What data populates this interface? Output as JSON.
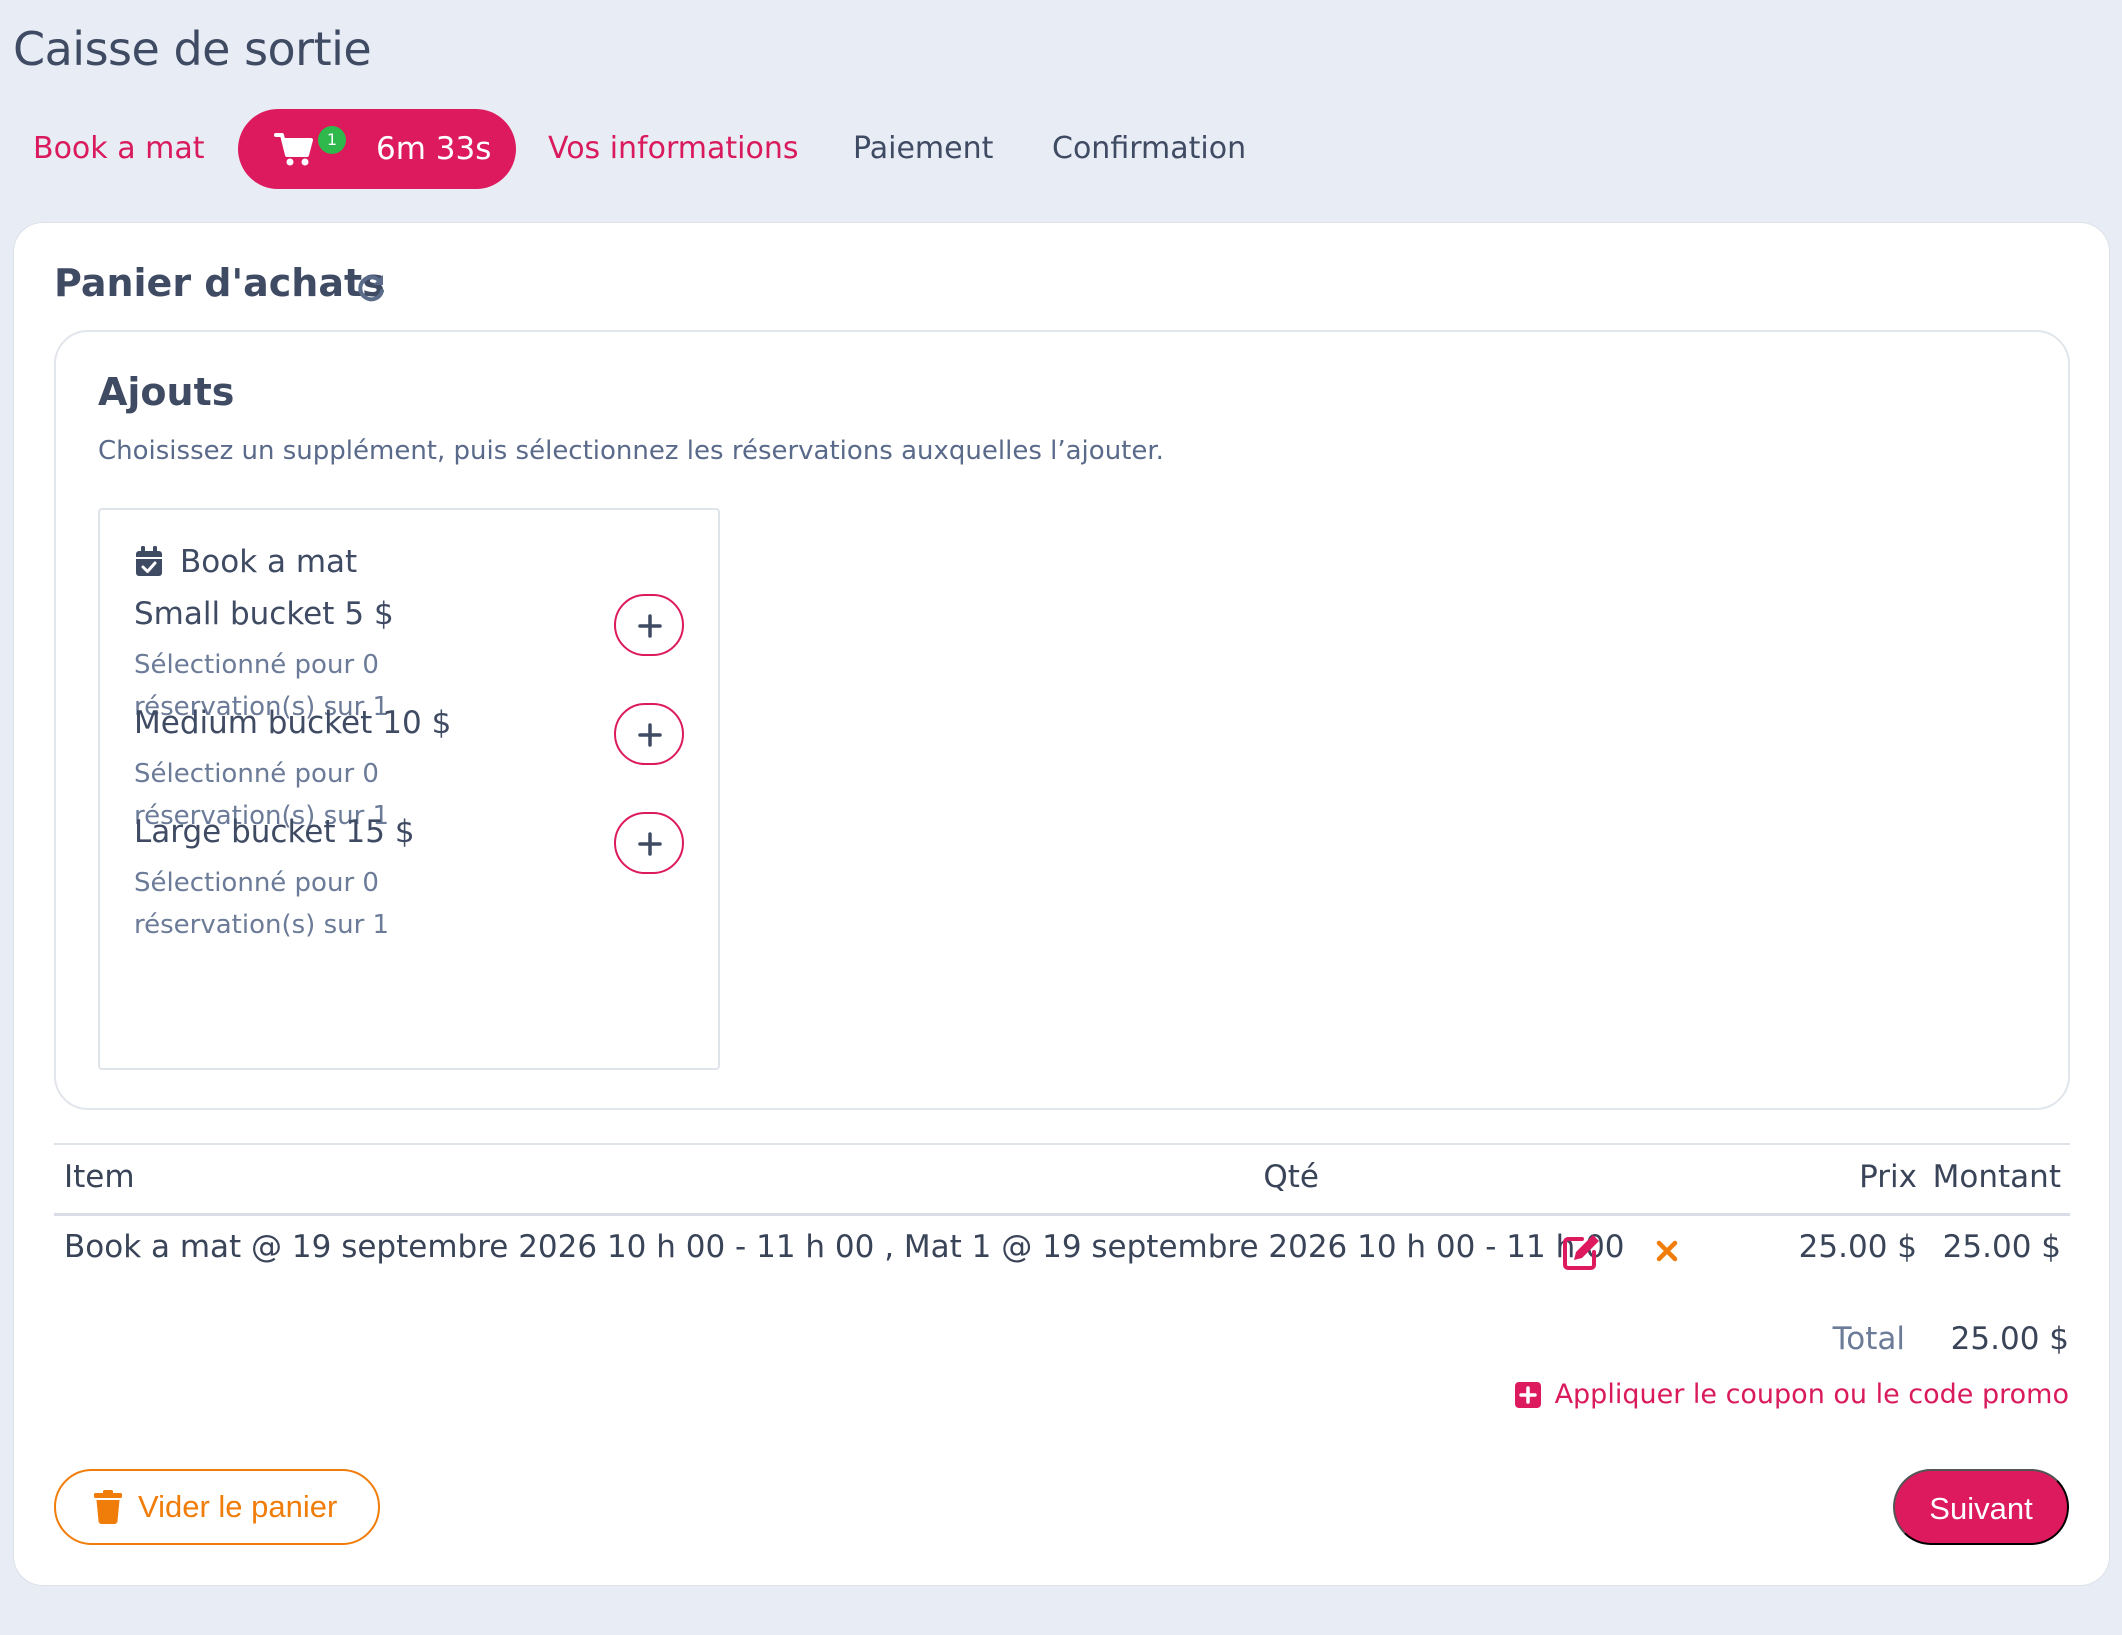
{
  "page": {
    "title": "Caisse de sortie"
  },
  "steps": {
    "book": "Book a mat",
    "cart_badge": "1",
    "cart_timer": "6m 33s",
    "info": "Vos informations",
    "payment": "Paiement",
    "confirmation": "Confirmation"
  },
  "cart": {
    "title": "Panier d'achats",
    "addons": {
      "title": "Ajouts",
      "hint": "Choisissez un supplément, puis sélectionnez les réservations auxquelles l’ajouter.",
      "product": "Book a mat",
      "items": [
        {
          "name": "Small bucket",
          "price": "5 $",
          "selection": "Sélectionné pour 0 réservation(s) sur 1"
        },
        {
          "name": "Medium bucket",
          "price": "10 $",
          "selection": "Sélectionné pour 0 réservation(s) sur 1"
        },
        {
          "name": "Large bucket",
          "price": "15 $",
          "selection": "Sélectionné pour 0 réservation(s) sur 1"
        }
      ]
    },
    "table": {
      "headers": {
        "item": "Item",
        "qty": "Qté",
        "price": "Prix",
        "amount": "Montant"
      },
      "rows": [
        {
          "item": "Book a mat @ 19 septembre 2026 10 h 00 - 11 h 00 , Mat 1 @ 19 septembre 2026 10 h 00 - 11 h 00",
          "qty": "",
          "price": "25.00 $",
          "amount": "25.00 $"
        }
      ]
    },
    "total_label": "Total",
    "total_value": "25.00 $",
    "coupon_label": "Appliquer le coupon ou le code promo",
    "clear_label": "Vider le panier",
    "next_label": "Suivant"
  },
  "colors": {
    "accent": "#dc1a5d",
    "warning": "#f07d0a",
    "badge": "#2fb84b",
    "background": "#e8ecf4"
  }
}
